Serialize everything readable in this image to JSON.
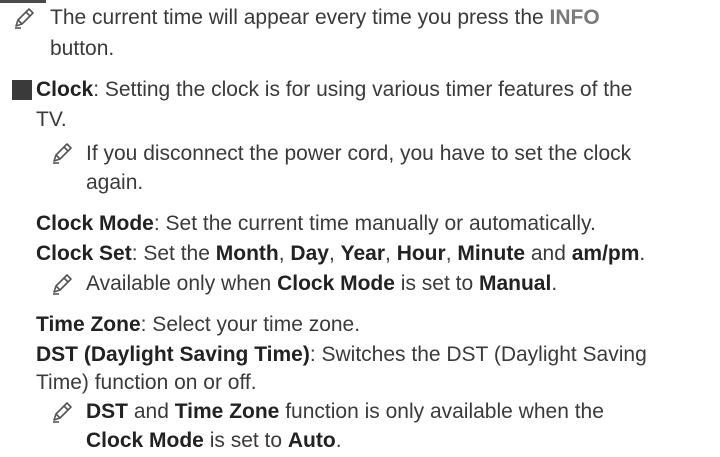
{
  "note1": {
    "line1_a": "The current time will appear every time you press the ",
    "line1_b": "INFO",
    "line2": "button."
  },
  "clock": {
    "label": "Clock",
    "desc_line1": ": Setting the clock is for using various timer features of the",
    "desc_line2": "TV."
  },
  "note2": {
    "line1": "If you disconnect the power cord, you have to set the clock",
    "line2": "again."
  },
  "clock_mode": {
    "label": "Clock Mode",
    "desc": ": Set the current time manually or automatically."
  },
  "clock_set": {
    "label": "Clock Set",
    "t1": ": Set the ",
    "month": "Month",
    "c1": ", ",
    "day": "Day",
    "c2": ", ",
    "year": "Year",
    "c3": ", ",
    "hour": "Hour",
    "c4": ", ",
    "minute": "Minute",
    "and": " and ",
    "ampm": "am/pm",
    "end": "."
  },
  "note3": {
    "t1": "Available only when ",
    "clock_mode": "Clock Mode",
    "t2": " is set to ",
    "manual": "Manual",
    "end": "."
  },
  "time_zone": {
    "label": "Time Zone",
    "desc": ": Select your time zone."
  },
  "dst": {
    "label": "DST (Daylight Saving Time)",
    "desc_line1": ": Switches the DST (Daylight Saving",
    "desc_line2": "Time) function on or off."
  },
  "note4": {
    "dst": "DST",
    "and": " and ",
    "time_zone": "Time Zone",
    "t1": " function is only available when the",
    "clock_mode": "Clock Mode",
    "t2": " is set to ",
    "auto": "Auto",
    "end": "."
  },
  "icons": {
    "note": "pencil-note-icon",
    "bullet": "square-bullet-icon"
  }
}
